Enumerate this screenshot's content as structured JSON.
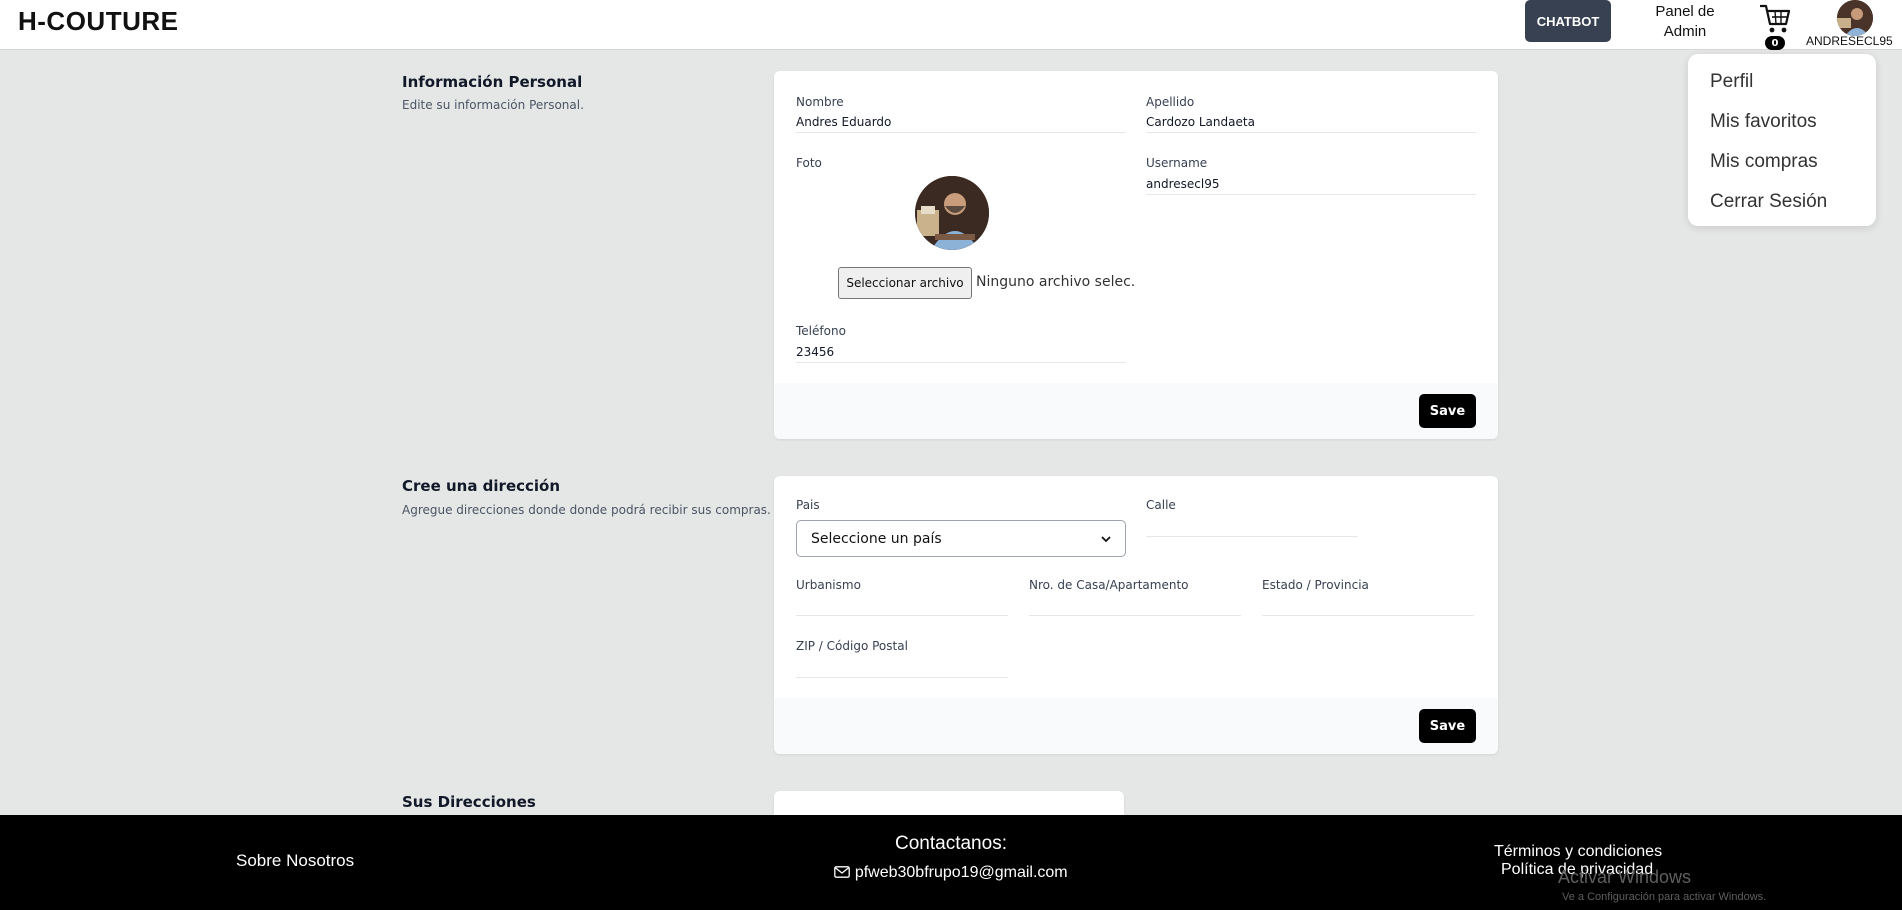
{
  "header": {
    "logo": "H-COUTURE",
    "chatbot": "CHATBOT",
    "admin_line1": "Panel de",
    "admin_line2": "Admin",
    "cart_count": "0",
    "username": "ANDRESECL95"
  },
  "dropdown": {
    "items": [
      "Perfil",
      "Mis favoritos",
      "Mis compras",
      "Cerrar Sesión"
    ]
  },
  "personal": {
    "title": "Información Personal",
    "description": "Edite su información Personal.",
    "nombre_label": "Nombre",
    "nombre_value": "Andres Eduardo",
    "apellido_label": "Apellido",
    "apellido_value": "Cardozo Landaeta",
    "foto_label": "Foto",
    "username_label": "Username",
    "username_value": "andresecl95",
    "file_button": "Seleccionar archivo",
    "file_status": "Ninguno archivo selec.",
    "telefono_label": "Teléfono",
    "telefono_value": "23456",
    "save": "Save"
  },
  "address": {
    "title": "Cree una dirección",
    "description": "Agregue direcciones donde donde podrá recibir sus compras.",
    "pais_label": "Pais",
    "pais_selected": "Seleccione un país",
    "calle_label": "Calle",
    "urbanismo_label": "Urbanismo",
    "casa_label": "Nro. de Casa/Apartamento",
    "estado_label": "Estado / Provincia",
    "zip_label": "ZIP / Código Postal",
    "save": "Save"
  },
  "sus_direcciones": {
    "title": "Sus Direcciones"
  },
  "footer": {
    "about": "Sobre Nosotros",
    "contact_title": "Contactanos:",
    "contact_email": "pfweb30bfrupo19@gmail.com",
    "terms": "Términos y condiciones",
    "privacy": "Política de privacidad"
  },
  "watermark": {
    "title": "Activar Windows",
    "subtitle": "Ve a Configuración para activar Windows."
  },
  "colors": {
    "page_bg": "#e5e6e6",
    "chatbot_bg": "#374151",
    "save_bg": "#000000",
    "footer_bg": "#000000"
  },
  "icons": [
    "cart-icon",
    "avatar",
    "chevron-down-icon",
    "mail-icon"
  ]
}
